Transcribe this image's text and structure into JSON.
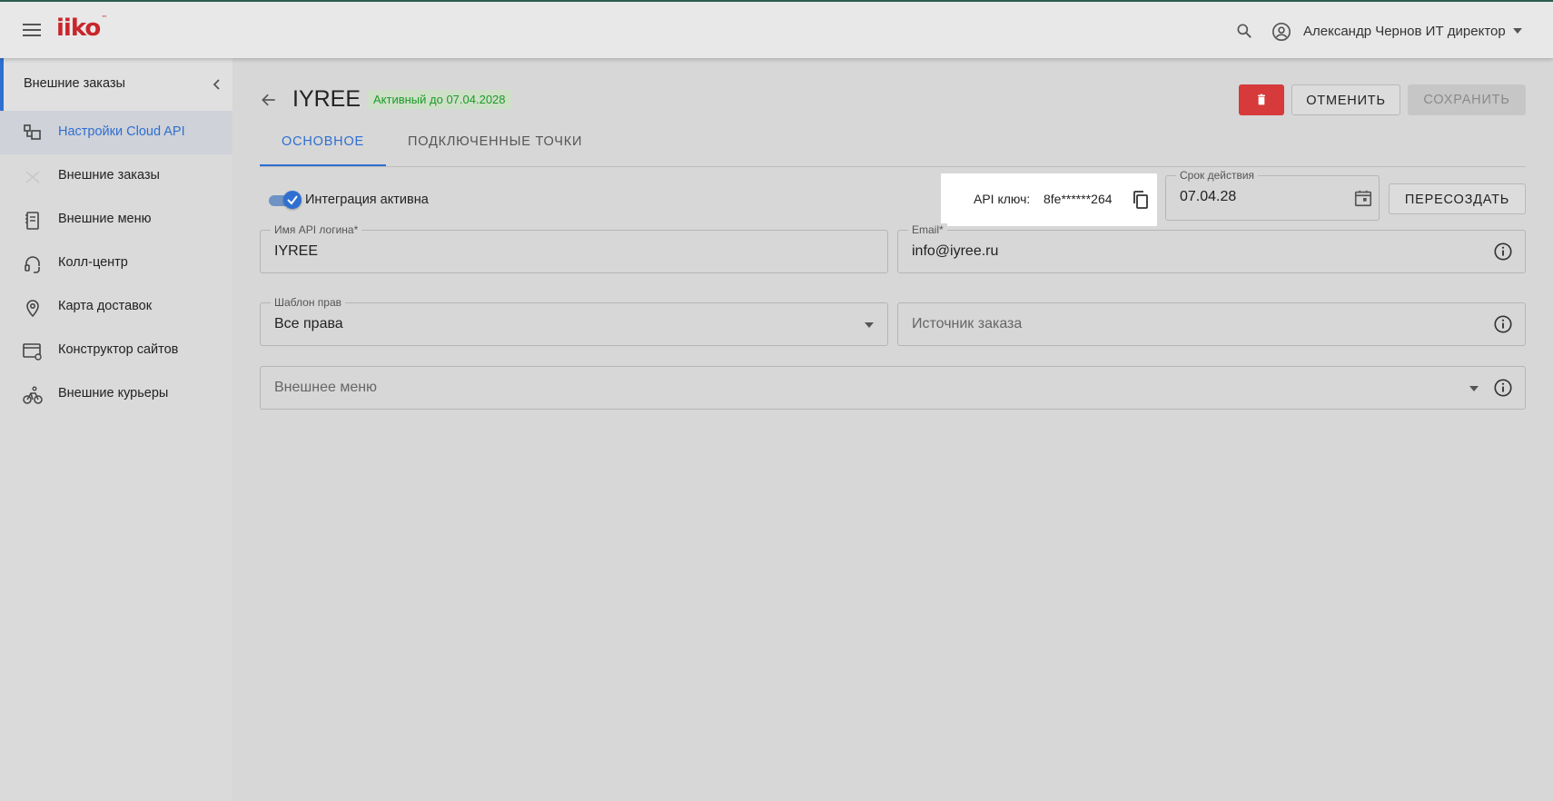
{
  "header": {
    "logo_text": "iiko",
    "logo_tm": "™",
    "user_name": "Александр Чернов ИТ директор"
  },
  "sidebar": {
    "section_title": "Внешние заказы",
    "items": [
      {
        "label": "Настройки Cloud API",
        "icon": "cloud-api-settings-icon",
        "active": true
      },
      {
        "label": "Внешние заказы",
        "icon": "external-orders-icon",
        "active": false
      },
      {
        "label": "Внешние меню",
        "icon": "external-menu-icon",
        "active": false
      },
      {
        "label": "Колл-центр",
        "icon": "headset-icon",
        "active": false
      },
      {
        "label": "Карта доставок",
        "icon": "map-pin-icon",
        "active": false
      },
      {
        "label": "Конструктор сайтов",
        "icon": "site-builder-icon",
        "active": false
      },
      {
        "label": "Внешние курьеры",
        "icon": "bicycle-courier-icon",
        "active": false
      }
    ]
  },
  "page": {
    "title": "IYREE",
    "status_badge": "Активный до 07.04.2028",
    "cancel_label": "ОТМЕНИТЬ",
    "save_label": "СОХРАНИТЬ",
    "tabs": [
      {
        "label": "ОСНОВНОЕ",
        "active": true
      },
      {
        "label": "ПОДКЛЮЧЕННЫЕ ТОЧКИ",
        "active": false
      }
    ]
  },
  "form": {
    "integration_toggle_label": "Интеграция активна",
    "integration_active": true,
    "api_key_label": "API ключ:",
    "api_key_value": "8fe******264",
    "expiry_label": "Срок действия",
    "expiry_value": "07.04.28",
    "recreate_label": "ПЕРЕСОЗДАТЬ",
    "api_login_label": "Имя API логина*",
    "api_login_value": "IYREE",
    "email_label": "Email*",
    "email_value": "info@iyree.ru",
    "rights_label": "Шаблон прав",
    "rights_value": "Все права",
    "order_source_placeholder": "Источник заказа",
    "external_menu_placeholder": "Внешнее меню"
  },
  "colors": {
    "accent": "#2f6fd0",
    "brand": "#c8262b",
    "danger": "#d63a3a",
    "success": "#1a9a2a"
  }
}
